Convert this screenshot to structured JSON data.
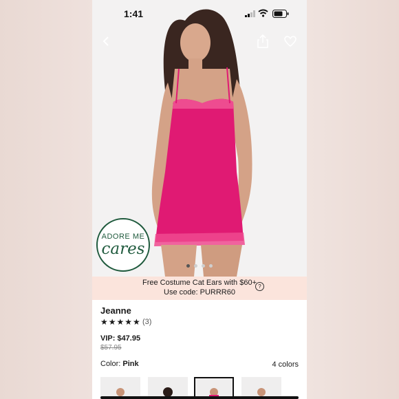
{
  "status": {
    "time": "1:41"
  },
  "nav": {
    "back_icon": "chevron-left-icon",
    "share_icon": "share-icon",
    "fav_icon": "heart-icon"
  },
  "badge": {
    "line1": "ADORE ME",
    "line2": "cares"
  },
  "gallery": {
    "dot_count": 4,
    "active_index": 0
  },
  "promo": {
    "line1": "Free Costume Cat Ears with $60+",
    "line2": "Use code: PURRR60",
    "help": "?"
  },
  "product": {
    "name": "Jeanne",
    "stars": "★★★★★",
    "rating": 5,
    "review_count": "(3)",
    "vip_price": "VIP: $47.95",
    "original_price": "$57.95",
    "color_label": "Color: ",
    "color_value": "Pink",
    "colors_count": "4 colors"
  },
  "colors": {
    "accent": "#e0166f",
    "badge_green": "#1f5a3d",
    "promo_bg": "#fbe4dc"
  }
}
